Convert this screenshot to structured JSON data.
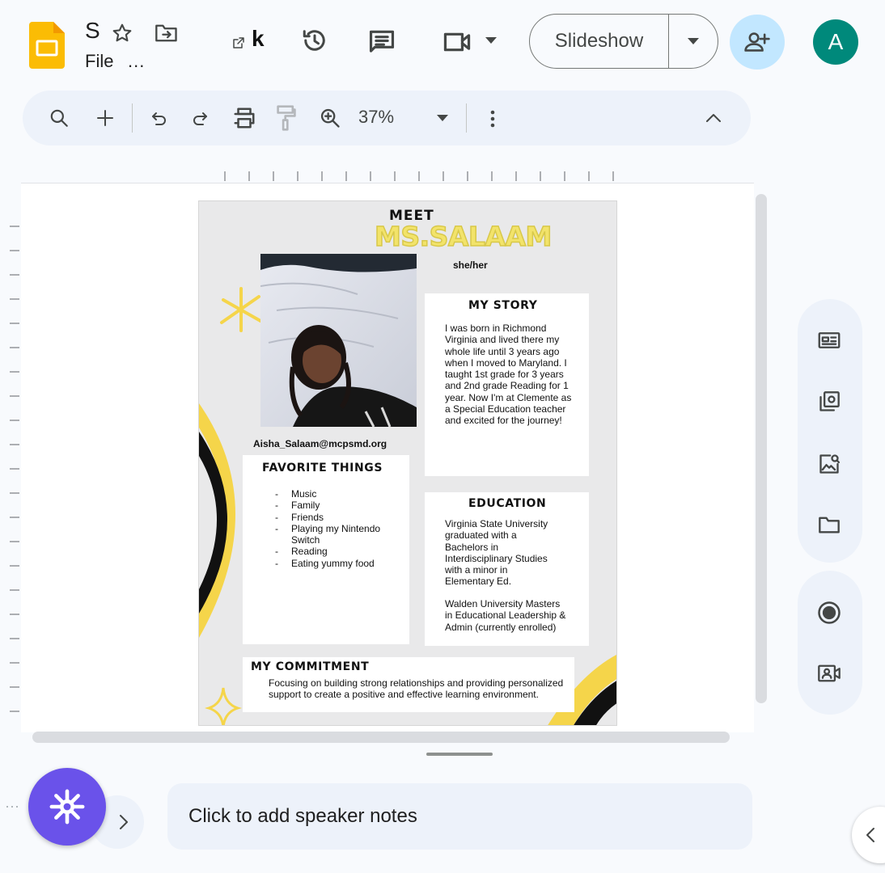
{
  "header": {
    "doc_title": "S",
    "file_menu": "File",
    "more_menus": "...",
    "slideshow_label": "Slideshow",
    "avatar_initial": "A",
    "klaviyo_k": "k"
  },
  "toolbar": {
    "zoom": "37%"
  },
  "slide": {
    "meet": "MEET",
    "name": "MS.SALAAM",
    "pronouns": "she/her",
    "email": "Aisha_Salaam@mcpsmd.org",
    "story": {
      "title": "MY STORY",
      "text": "I was born in Richmond Virginia and lived there my whole life until 3 years ago when I moved to Maryland. I taught 1st grade for 3 years and 2nd grade Reading for 1 year. Now I'm at Clemente as a Special Education teacher and excited for the journey!"
    },
    "favorites": {
      "title": "FAVORITE THINGS",
      "items": [
        "Music",
        "Family",
        "Friends",
        "Playing my Nintendo Switch",
        "Reading",
        "Eating yummy food"
      ]
    },
    "education": {
      "title": "EDUCATION",
      "text1": "Virginia State University graduated with a Bachelors in Interdisciplinary Studies with a minor in Elementary Ed.",
      "text2": "Walden University Masters in Educational Leadership & Admin (currently enrolled)"
    },
    "commitment": {
      "title": "MY COMMITMENT",
      "text": "Focusing on building strong relationships and providing personalized support to create a positive and effective learning environment."
    }
  },
  "notes": {
    "placeholder": "Click to add speaker notes"
  },
  "colors": {
    "accent_yellow": "#f5d54a",
    "share_bg": "#c2e7ff",
    "avatar_bg": "#00897b",
    "gemini_bg": "#6a52ea"
  }
}
